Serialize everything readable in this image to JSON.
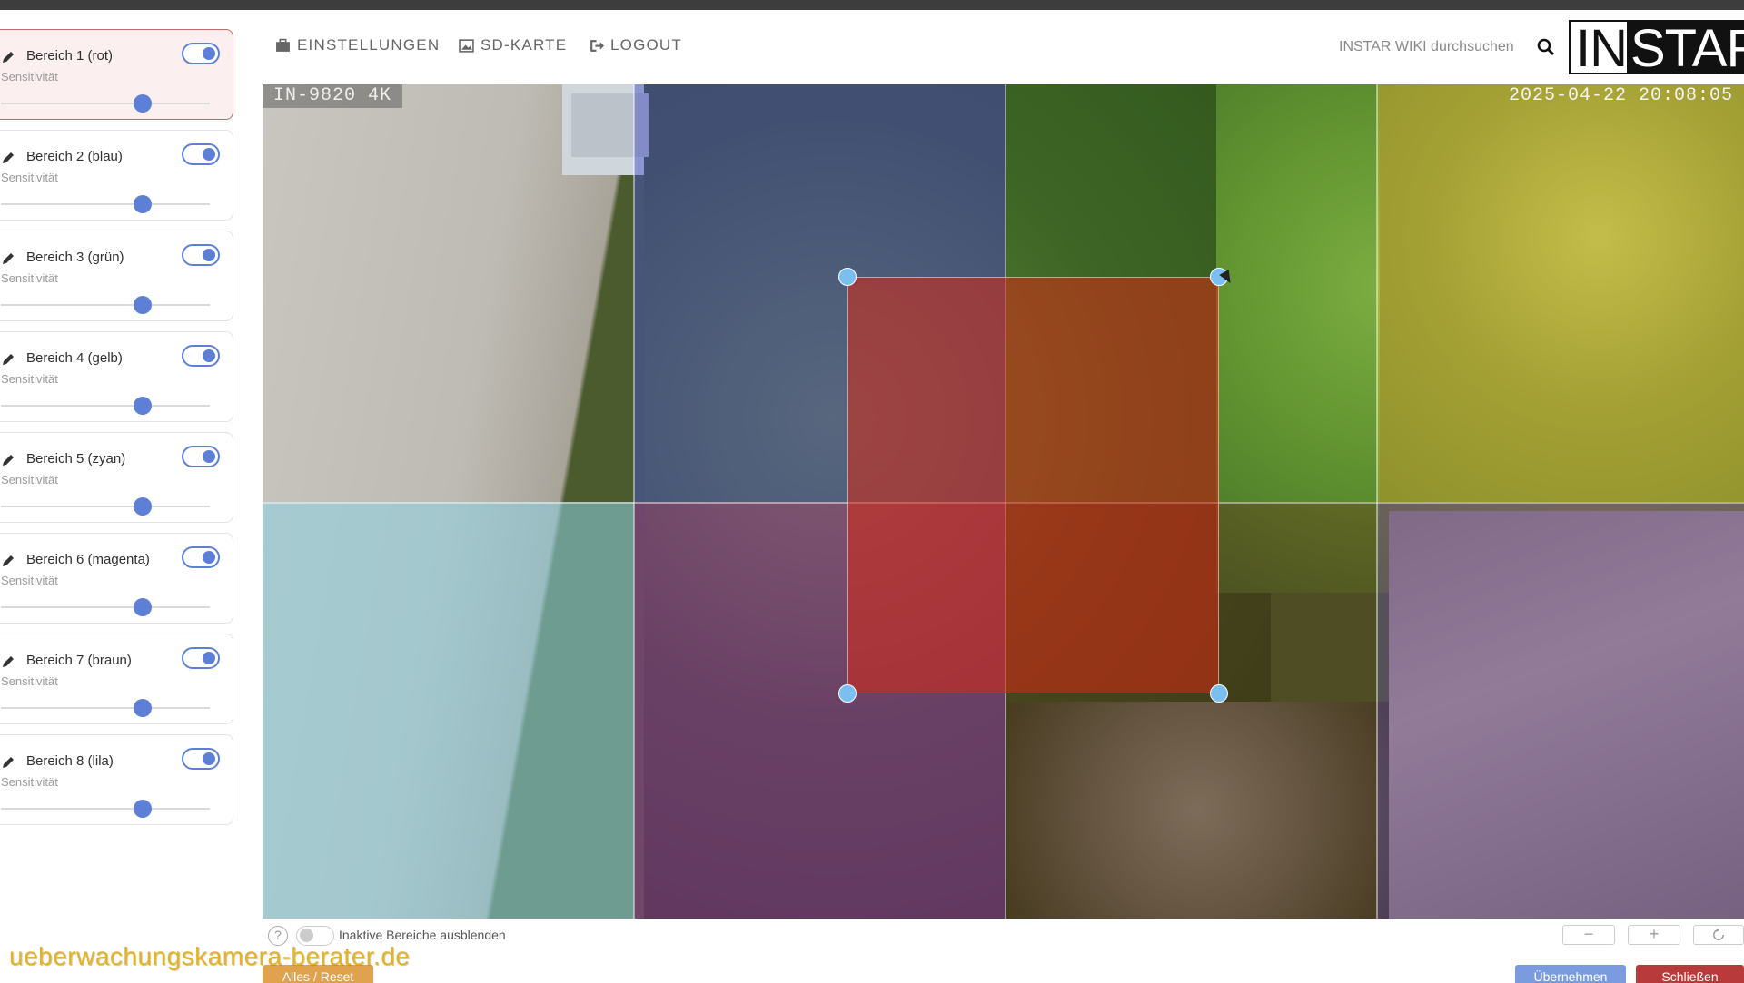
{
  "nav": {
    "settings": "EINSTELLUNGEN",
    "sdcard": "SD-KARTE",
    "logout": "LOGOUT",
    "search_placeholder": "INSTAR WIKI durchsuchen",
    "logo_a": "IN",
    "logo_b": "STAR"
  },
  "areas": [
    {
      "title": "Bereich 1 (rot)",
      "sub": "Sensitivität",
      "enabled": true,
      "sensitivity": 0.68
    },
    {
      "title": "Bereich 2 (blau)",
      "sub": "Sensitivität",
      "enabled": true,
      "sensitivity": 0.68
    },
    {
      "title": "Bereich 3 (grün)",
      "sub": "Sensitivität",
      "enabled": true,
      "sensitivity": 0.68
    },
    {
      "title": "Bereich 4 (gelb)",
      "sub": "Sensitivität",
      "enabled": true,
      "sensitivity": 0.68
    },
    {
      "title": "Bereich 5 (zyan)",
      "sub": "Sensitivität",
      "enabled": true,
      "sensitivity": 0.68
    },
    {
      "title": "Bereich 6 (magenta)",
      "sub": "Sensitivität",
      "enabled": true,
      "sensitivity": 0.68
    },
    {
      "title": "Bereich 7 (braun)",
      "sub": "Sensitivität",
      "enabled": true,
      "sensitivity": 0.68
    },
    {
      "title": "Bereich 8 (lila)",
      "sub": "Sensitivität",
      "enabled": true,
      "sensitivity": 0.68
    }
  ],
  "camera": {
    "name": "IN-9820 4K",
    "timestamp": "2025-04-22 20:08:05"
  },
  "bottom": {
    "help": "?",
    "hide_inactive": "Inaktive Bereiche ausblenden",
    "zoom_out": "−",
    "zoom_in": "+",
    "reset": "Alles / Reset",
    "apply": "Übernehmen",
    "close": "Schließen"
  },
  "watermark": "ueberwachungskamera-berater.de",
  "colors": {
    "accent": "#5d7fd6",
    "active_area": "#c36a6a",
    "red_area": "#d72814",
    "watermark": "#e3b325"
  }
}
